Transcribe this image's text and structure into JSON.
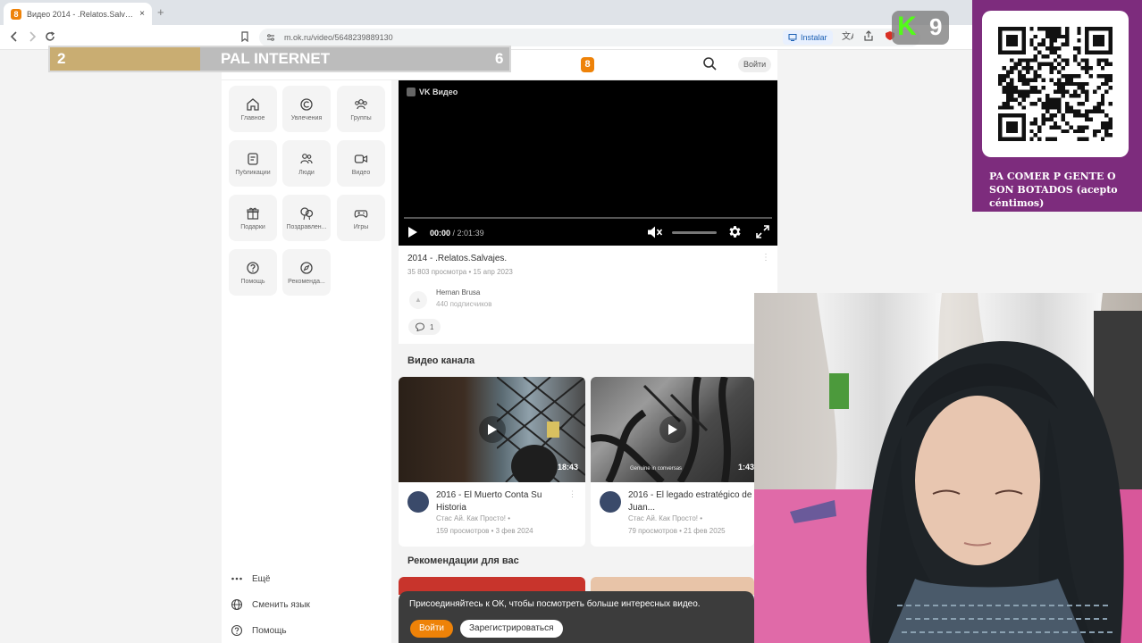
{
  "browser": {
    "tab_title": "Видео 2014 - .Relatos.Salvajes. |",
    "tab_close": "×",
    "new_tab": "+",
    "url": "m.ok.ru/video/5648239889130",
    "install_label": "Instalar"
  },
  "header": {
    "logo": "8",
    "login_label": "Войти"
  },
  "sidebar": {
    "items": [
      {
        "label": "Главное",
        "icon": "home-icon"
      },
      {
        "label": "Увлечения",
        "icon": "hobby-icon"
      },
      {
        "label": "Группы",
        "icon": "groups-icon"
      },
      {
        "label": "Публикации",
        "icon": "posts-icon"
      },
      {
        "label": "Люди",
        "icon": "people-icon"
      },
      {
        "label": "Видео",
        "icon": "video-icon"
      },
      {
        "label": "Подарки",
        "icon": "gift-icon"
      },
      {
        "label": "Поздравлен...",
        "icon": "congrats-icon"
      },
      {
        "label": "Игры",
        "icon": "gamepad-icon"
      },
      {
        "label": "Помощь",
        "icon": "help-icon"
      },
      {
        "label": "Рекоменда...",
        "icon": "compass-icon"
      }
    ],
    "more_label": "Ещё",
    "lang_label": "Сменить язык",
    "help_label": "Помощь"
  },
  "player": {
    "badge": "VK Видео",
    "current_time": "00:00",
    "separator": " / ",
    "total_time": "2:01:39",
    "progress": 0.0
  },
  "video": {
    "title": "2014 - .Relatos.Salvajes.",
    "meta": "35 803 просмотра • 15 апр 2023",
    "channel_name": "Hernan Brusa",
    "channel_subs": "440 подписчиков",
    "channel_avatar": "▲",
    "comments_count": "1"
  },
  "channel_videos": {
    "heading": "Видео канала",
    "items": [
      {
        "title": "2016 - El Muerto Conta Su Historia",
        "author": "Стас Ай. Как Просто! •",
        "meta": "159 просмотров • 3 фев 2024",
        "duration": "18:43",
        "caption": ""
      },
      {
        "title": "2016 - El legado estratégico de Juan...",
        "author": "Стас Ай. Как Просто! •",
        "meta": "79 просмотров • 21 фев 2025",
        "duration": "1:43",
        "caption": "Genuine in conversas"
      }
    ]
  },
  "recommendations": {
    "heading": "Рекомендации для вас"
  },
  "join_banner": {
    "text": "Присоединяйтесь к ОК, чтобы посмотреть больше интересных видео.",
    "login": "Войти",
    "register": "Зарегистрироваться"
  },
  "overlay": {
    "score_left": "2",
    "score_title": "PAL INTERNET",
    "score_right": "6",
    "kick_letter": "K",
    "kick_number": "9",
    "qr_caption": "PA COMER P GENTE O SON BOTADOS (acepto céntimos)"
  },
  "colors": {
    "ok_orange": "#ee8208",
    "qr_panel": "#7d2c7d",
    "kick_green": "#53fc18",
    "score_gold": "#c9ad72"
  }
}
